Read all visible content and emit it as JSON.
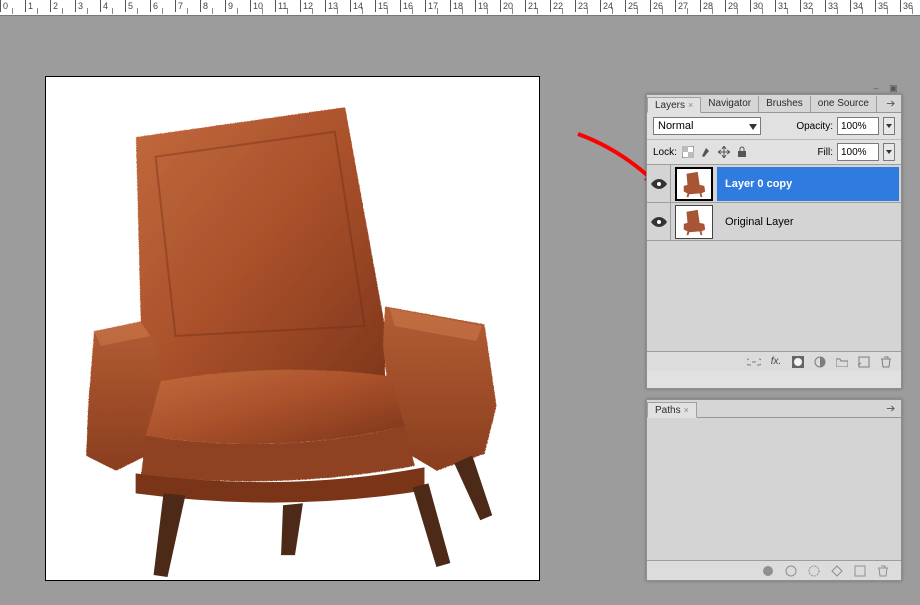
{
  "ruler": {
    "labels": [
      0,
      1,
      2,
      3,
      4,
      5,
      6,
      7,
      8,
      9,
      10,
      11,
      12,
      13,
      14,
      15,
      16,
      17,
      18,
      19,
      20,
      21,
      22,
      23,
      24,
      25,
      26,
      27,
      28,
      29,
      30,
      31,
      32,
      33,
      34,
      35,
      36
    ]
  },
  "panels": {
    "layers": {
      "tabs": [
        "Layers",
        "Navigator",
        "Brushes",
        "one Source"
      ],
      "blend_mode": "Normal",
      "opacity_label": "Opacity:",
      "opacity_value": "100%",
      "lock_label": "Lock:",
      "fill_label": "Fill:",
      "fill_value": "100%",
      "items": [
        {
          "name": "Layer 0 copy",
          "selected": true,
          "visible": true
        },
        {
          "name": "Original Layer",
          "selected": false,
          "visible": true
        }
      ]
    },
    "paths": {
      "tab": "Paths"
    }
  },
  "annotation": {
    "arrow_color": "#ff0000"
  }
}
